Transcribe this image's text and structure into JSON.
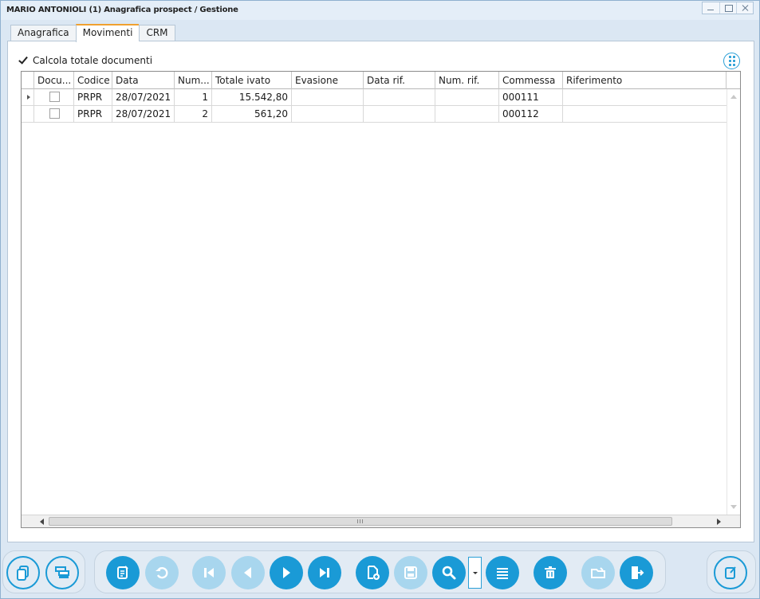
{
  "window": {
    "title": "MARIO ANTONIOLI (1) Anagrafica prospect / Gestione"
  },
  "tabs": [
    {
      "label": "Anagrafica",
      "active": false
    },
    {
      "label": "Movimenti",
      "active": true
    },
    {
      "label": "CRM",
      "active": false
    }
  ],
  "options": {
    "calcola_totale": {
      "label": "Calcola totale documenti",
      "checked": true
    }
  },
  "table": {
    "columns": [
      "Docu...",
      "Codice",
      "Data",
      "Num...",
      "Totale ivato",
      "Evasione",
      "Data rif.",
      "Num. rif.",
      "Commessa",
      "Riferimento"
    ],
    "rows": [
      {
        "docu": false,
        "codice": "PRPR",
        "data": "28/07/2021",
        "num": "1",
        "totale": "15.542,80",
        "evasione": "",
        "data_rif": "",
        "num_rif": "",
        "commessa": "000111",
        "riferimento": ""
      },
      {
        "docu": false,
        "codice": "PRPR",
        "data": "28/07/2021",
        "num": "2",
        "totale": "561,20",
        "evasione": "",
        "data_rif": "",
        "num_rif": "",
        "commessa": "000112",
        "riferimento": ""
      }
    ]
  },
  "toolbar": {
    "icons": [
      "copy-pages-icon",
      "stack-layers-icon",
      "edit-document-icon",
      "undo-icon",
      "first-record-icon",
      "previous-record-icon",
      "next-record-icon",
      "last-record-icon",
      "new-document-icon",
      "save-icon",
      "search-icon",
      "list-icon",
      "delete-icon",
      "folder-edit-icon",
      "exit-icon",
      "edit-note-icon"
    ]
  },
  "colors": {
    "accent": "#1a9ad6",
    "disabled_accent": "#a8d6ee",
    "active_tab_marker": "#f0a030",
    "window_bg": "#dbe7f3"
  }
}
